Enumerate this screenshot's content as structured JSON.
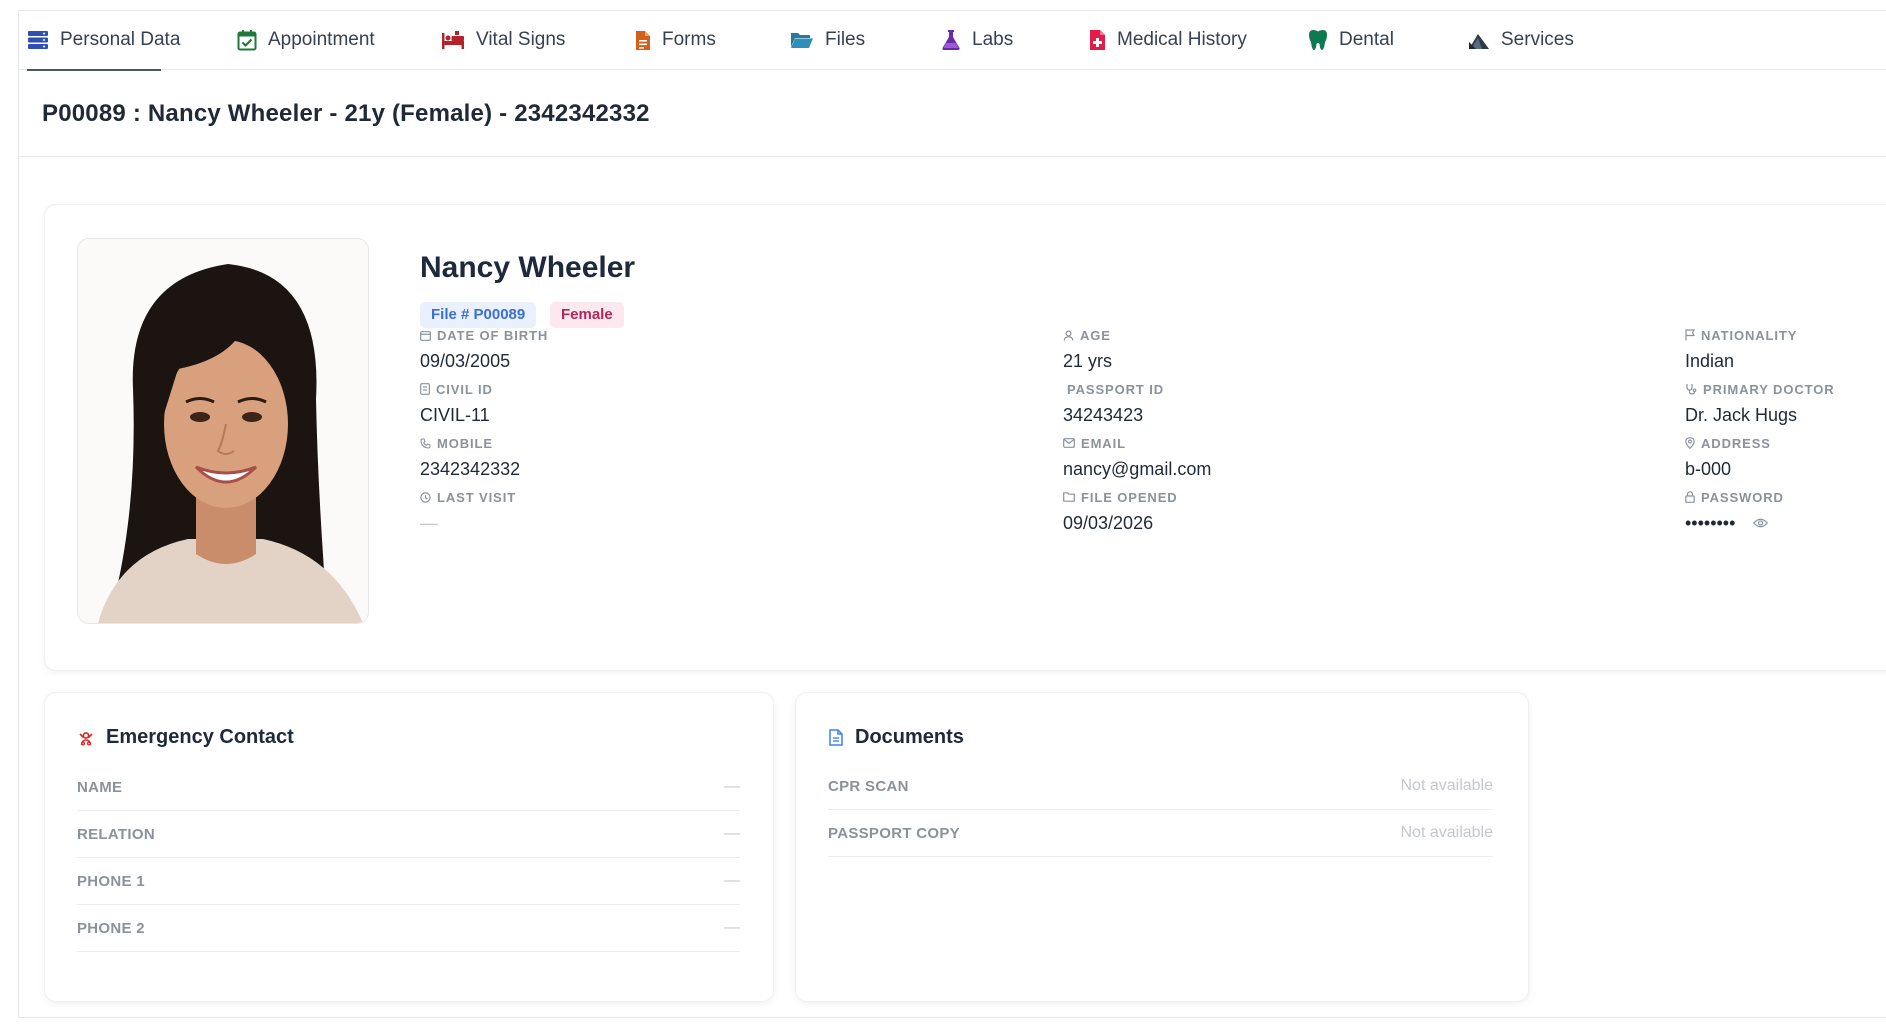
{
  "tabs": [
    {
      "label": "Personal Data",
      "icon": "server-stack-icon",
      "active": true
    },
    {
      "label": "Appointment",
      "icon": "calendar-check-icon"
    },
    {
      "label": "Vital Signs",
      "icon": "hospital-bed-icon"
    },
    {
      "label": "Forms",
      "icon": "document-icon"
    },
    {
      "label": "Files",
      "icon": "folder-open-icon"
    },
    {
      "label": "Labs",
      "icon": "flask-icon"
    },
    {
      "label": "Medical History",
      "icon": "medical-file-icon"
    },
    {
      "label": "Dental",
      "icon": "tooth-icon"
    },
    {
      "label": "Services",
      "icon": "services-icon"
    }
  ],
  "header": {
    "title": "P00089 : Nancy Wheeler - 21y (Female) - 2342342332"
  },
  "profile": {
    "name": "Nancy Wheeler",
    "file_badge": "File # P00089",
    "gender_badge": "Female",
    "fields": {
      "dob": {
        "label": "DATE OF BIRTH",
        "value": "09/03/2005"
      },
      "civil_id": {
        "label": "CIVIL ID",
        "value": "CIVIL-11"
      },
      "mobile": {
        "label": "MOBILE",
        "value": "2342342332"
      },
      "last_visit": {
        "label": "LAST VISIT",
        "value": "—"
      },
      "age": {
        "label": "AGE",
        "value": "21 yrs"
      },
      "passport_id": {
        "label": "PASSPORT ID",
        "value": "34243423"
      },
      "email": {
        "label": "EMAIL",
        "value": "nancy@gmail.com"
      },
      "file_opened": {
        "label": "FILE OPENED",
        "value": "09/03/2026"
      },
      "nationality": {
        "label": "NATIONALITY",
        "value": "Indian"
      },
      "primary_doctor": {
        "label": "PRIMARY DOCTOR",
        "value": "Dr. Jack Hugs"
      },
      "address": {
        "label": "ADDRESS",
        "value": "b-000"
      },
      "password": {
        "label": "PASSWORD",
        "value": "••••••••"
      }
    }
  },
  "emergency": {
    "title": "Emergency Contact",
    "rows": [
      {
        "label": "NAME",
        "value": "—"
      },
      {
        "label": "RELATION",
        "value": "—"
      },
      {
        "label": "PHONE 1",
        "value": "—"
      },
      {
        "label": "PHONE 2",
        "value": "—"
      }
    ]
  },
  "documents": {
    "title": "Documents",
    "rows": [
      {
        "label": "CPR SCAN",
        "value": "Not available"
      },
      {
        "label": "PASSPORT COPY",
        "value": "Not available"
      }
    ]
  },
  "colors": {
    "file_badge_bg": "#eaf1fd",
    "file_badge_text": "#3b6fd1",
    "gender_badge_bg": "#fde8f0",
    "gender_badge_text": "#b0285a",
    "emergency_icon": "#dc2626",
    "documents_icon": "#3b82f6"
  }
}
